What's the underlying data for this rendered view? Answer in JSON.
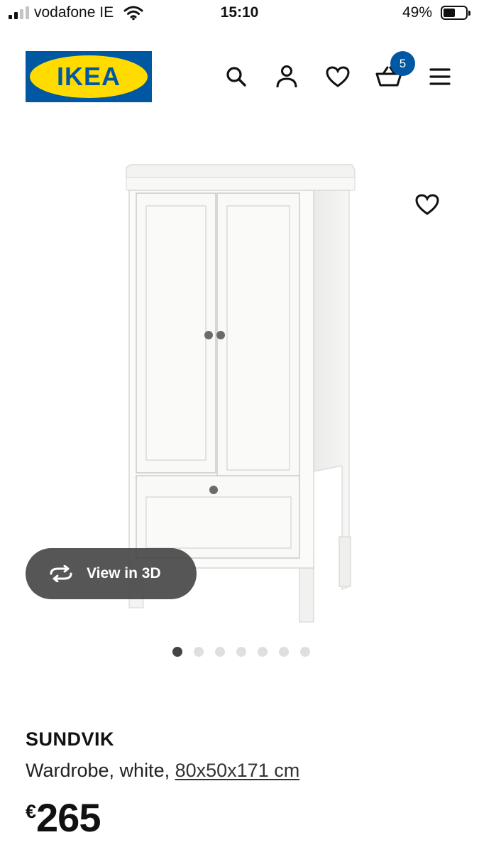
{
  "status_bar": {
    "carrier": "vodafone IE",
    "time": "15:10",
    "battery_percent": "49%",
    "battery_level": 0.49
  },
  "header": {
    "logo_text": "IKEA",
    "brand_colors": {
      "blue": "#0058a3",
      "yellow": "#ffdb00"
    },
    "icons": [
      "search-icon",
      "account-icon",
      "wishlist-heart-icon",
      "basket-icon",
      "menu-icon"
    ],
    "cart_count": "5"
  },
  "gallery": {
    "view_3d_label": "View in 3D",
    "image_count": 7,
    "active_index": 0
  },
  "product": {
    "name": "SUNDVIK",
    "description_prefix": "Wardrobe, white, ",
    "dimensions": "80x50x171 cm",
    "currency": "€",
    "price": "265"
  }
}
